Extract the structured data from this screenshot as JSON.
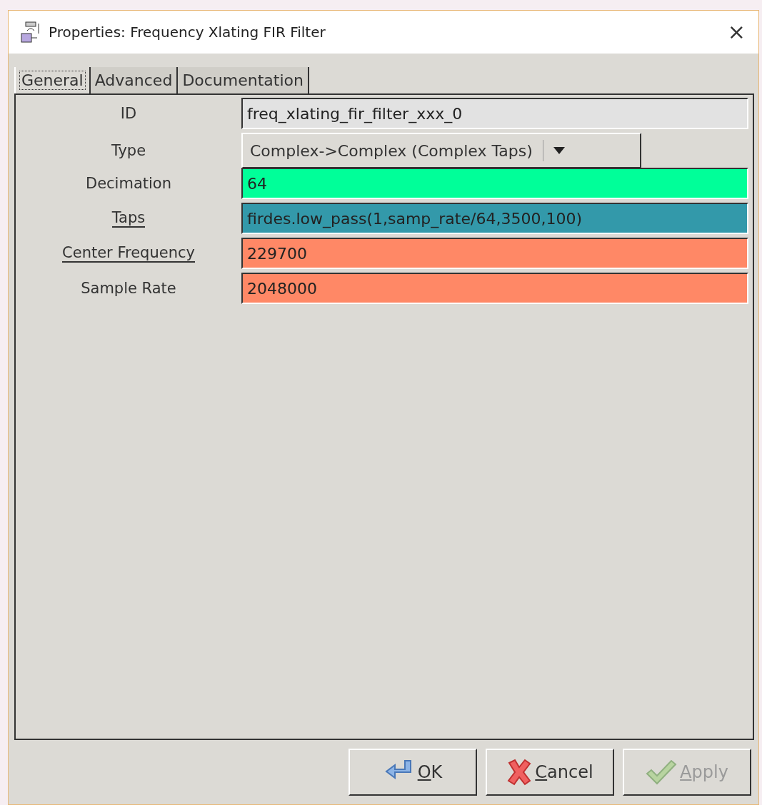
{
  "window": {
    "title": "Properties: Frequency Xlating FIR Filter",
    "close": "×"
  },
  "tabs": [
    {
      "label": "General",
      "selected": true
    },
    {
      "label": "Advanced",
      "selected": false
    },
    {
      "label": "Documentation",
      "selected": false
    }
  ],
  "params": [
    {
      "label": "ID",
      "underlined": false,
      "kind": "entry",
      "value": "freq_xlating_fir_filter_xxx_0",
      "color": "#e2e2e2"
    },
    {
      "label": "Type",
      "underlined": false,
      "kind": "combo",
      "value": "Complex->Complex (Complex Taps)",
      "color": "#dcdad5"
    },
    {
      "label": "Decimation",
      "underlined": false,
      "kind": "entry",
      "value": "64",
      "color": "#00ff99"
    },
    {
      "label": "Taps",
      "underlined": true,
      "kind": "entry",
      "value": "firdes.low_pass(1,samp_rate/64,3500,100)",
      "color": "#3399aa"
    },
    {
      "label": "Center Frequency",
      "underlined": true,
      "kind": "entry",
      "value": "229700",
      "color": "#ff8866"
    },
    {
      "label": "Sample Rate",
      "underlined": false,
      "kind": "entry",
      "value": "2048000",
      "color": "#ff8866"
    }
  ],
  "buttons": [
    {
      "kind": "ok",
      "mnemonic": "O",
      "rest": "K",
      "disabled": false
    },
    {
      "kind": "cancel",
      "mnemonic": "C",
      "rest": "ancel",
      "disabled": false
    },
    {
      "kind": "apply",
      "mnemonic": "A",
      "rest": "pply",
      "disabled": true
    }
  ]
}
